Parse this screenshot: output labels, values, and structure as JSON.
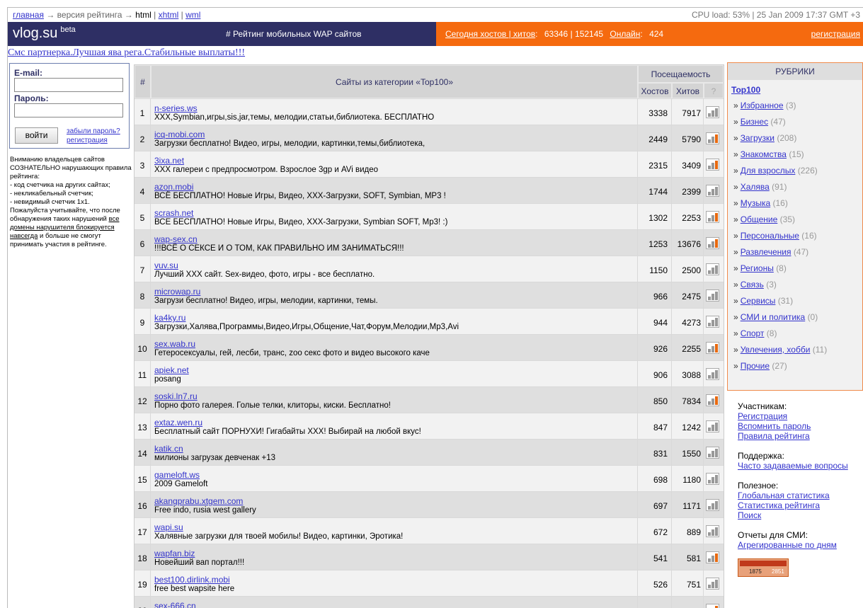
{
  "topline": {
    "home": "главная",
    "arrow1": "→",
    "rating_version": "версия рейтинга",
    "arrow2": "→",
    "html": "html",
    "sep1": "|",
    "xhtml": "xhtml",
    "sep2": "|",
    "wml": "wml",
    "cpu": "CPU load: 53%  |  25 Jan 2009 17:37 GMT +3"
  },
  "header": {
    "logo": "vlog.su",
    "beta": "beta",
    "tagline": "# Рейтинг мобильных WAP сайтов",
    "today_label": "Сегодня хостов | хитов",
    "today_values": "63346 | 152145",
    "online_label": "Онлайн",
    "online_value": "424",
    "register": "регистрация",
    "colors": {
      "left": "#2e2f64",
      "right": "#f56a0f"
    }
  },
  "promo": "Смс партнерка.Лучшая ява рега.Стабильные выплаты!!!",
  "login": {
    "email_label": "E-mail:",
    "password_label": "Пароль:",
    "submit": "войти",
    "forgot": "забыли пароль?",
    "register": "регистрация"
  },
  "warning": {
    "text1": "Вниманию владельцев сайтов СОЗНАТЕЛЬНО нарушающих правила рейтинга:",
    "text2": "- код счетчика на других сайтах;",
    "text3": "- некликабельный счетчик;",
    "text4": "- невидимый счетчик 1x1.",
    "text5": "Пожалуйста учитывайте, что после обнаружения таких нарушений",
    "link": "все домены нарушителя блокируется навсегда",
    "text6": "и больше не смогут принимать участия в рейтинге."
  },
  "table": {
    "col_num": "#",
    "col_sites": "Сайты из категории «Top100»",
    "col_visits": "Посещаемость",
    "col_hosts": "Хостов",
    "col_hits": "Хитов",
    "col_q": "?",
    "rows": [
      {
        "n": "1",
        "site": "n-series.ws",
        "desc": "XXX,Symbian,игры,sis,jar,темы, мелодии,статьи,библиотека. БЕСПЛАТНО",
        "hosts": "3338",
        "hits": "7917",
        "hot": false
      },
      {
        "n": "2",
        "site": "icq-mobi.com",
        "desc": "Загрузки бесплатно! Видео, игры, мелодии, картинки,темы,библиотека,",
        "hosts": "2449",
        "hits": "5790",
        "hot": true
      },
      {
        "n": "3",
        "site": "3ixa.net",
        "desc": "XXX галереи с предпросмотром. Взрослое 3gp и AVi видео",
        "hosts": "2315",
        "hits": "3409",
        "hot": true
      },
      {
        "n": "4",
        "site": "azon.mobi",
        "desc": "ВСЁ БЕСПЛАТНО! Новые Игры, Видео, XXX-Загрузки, SOFT, Symbian, MP3 !",
        "hosts": "1744",
        "hits": "2399",
        "hot": false
      },
      {
        "n": "5",
        "site": "scrash.net",
        "desc": "ВСЕ БЕСПЛАТНО! Новые Игры, Видео, XXX-Загрузки, Symbian SOFT, Mp3! :)",
        "hosts": "1302",
        "hits": "2253",
        "hot": true
      },
      {
        "n": "6",
        "site": "wap-sex.cn",
        "desc": "!!!ВСЁ О СЕКСЕ И О ТОМ, КАК ПРАВИЛЬНО ИМ ЗАНИМАТЬСЯ!!!",
        "hosts": "1253",
        "hits": "13676",
        "hot": true
      },
      {
        "n": "7",
        "site": "vuv.su",
        "desc": "Лучший XXX сайт. Sex-видео, фото, игры - все бесплатно.",
        "hosts": "1150",
        "hits": "2500",
        "hot": false
      },
      {
        "n": "8",
        "site": "microwap.ru",
        "desc": "Загрузи бесплатно! Видео, игры, мелодии, картинки, темы.",
        "hosts": "966",
        "hits": "2475",
        "hot": false
      },
      {
        "n": "9",
        "site": "ka4ky.ru",
        "desc": "Загрузки,Халява,Программы,Видео,Игры,Общение,Чат,Форум,Мелодии,Mp3,Avi",
        "hosts": "944",
        "hits": "4273",
        "hot": false
      },
      {
        "n": "10",
        "site": "sex.wab.ru",
        "desc": "Гетеросексуалы, гей, лесби, транс, zoo секс фото и видео высокого каче",
        "hosts": "926",
        "hits": "2255",
        "hot": true
      },
      {
        "n": "11",
        "site": "apiek.net",
        "desc": "posang",
        "hosts": "906",
        "hits": "3088",
        "hot": false
      },
      {
        "n": "12",
        "site": "soski.ln7.ru",
        "desc": "Порно фото галерея. Голые телки, клиторы, киски. Бесплатно!",
        "hosts": "850",
        "hits": "7834",
        "hot": true
      },
      {
        "n": "13",
        "site": "extaz.wen.ru",
        "desc": "Бесплатный сайт ПОРНУХИ! Гигабайты XXX! Выбирай на любой вкус!",
        "hosts": "847",
        "hits": "1242",
        "hot": false
      },
      {
        "n": "14",
        "site": "katik.cn",
        "desc": "милионы загрузак девченак +13",
        "hosts": "831",
        "hits": "1550",
        "hot": false
      },
      {
        "n": "15",
        "site": "gameloft.ws",
        "desc": "2009 Gameloft",
        "hosts": "698",
        "hits": "1180",
        "hot": false
      },
      {
        "n": "16",
        "site": "akangprabu.xtgem.com",
        "desc": "Free indo, rusia west gallery",
        "hosts": "697",
        "hits": "1171",
        "hot": false
      },
      {
        "n": "17",
        "site": "wapi.su",
        "desc": "Халявные загрузки для твоей мобилы! Видео, картинки, Эротика!",
        "hosts": "672",
        "hits": "889",
        "hot": false
      },
      {
        "n": "18",
        "site": "wapfan.biz",
        "desc": "Новейший вап портал!!!",
        "hosts": "541",
        "hits": "581",
        "hot": true
      },
      {
        "n": "19",
        "site": "best100.dirlink.mobi",
        "desc": "free best wapsite here",
        "hosts": "526",
        "hits": "751",
        "hot": false
      },
      {
        "n": "20",
        "site": "sex-666.cn",
        "desc": "",
        "hosts": "",
        "hits": "",
        "hot": true
      }
    ]
  },
  "rubrics": {
    "title": "РУБРИКИ",
    "top": "Top100",
    "items": [
      {
        "label": "Избранное",
        "count": "(3)"
      },
      {
        "label": "Бизнес",
        "count": "(47)"
      },
      {
        "label": "Загрузки",
        "count": "(208)"
      },
      {
        "label": "Знакомства",
        "count": "(15)"
      },
      {
        "label": "Для взрослых",
        "count": "(226)"
      },
      {
        "label": "Халява",
        "count": "(91)"
      },
      {
        "label": "Музыка",
        "count": "(16)"
      },
      {
        "label": "Общение",
        "count": "(35)"
      },
      {
        "label": "Персональные",
        "count": "(16)"
      },
      {
        "label": "Развлечения",
        "count": "(47)"
      },
      {
        "label": "Регионы",
        "count": "(8)"
      },
      {
        "label": "Связь",
        "count": "(3)"
      },
      {
        "label": "Сервисы",
        "count": "(31)"
      },
      {
        "label": "СМИ и политика",
        "count": "(0)"
      },
      {
        "label": "Спорт",
        "count": "(8)"
      },
      {
        "label": "Увлечения, хобби",
        "count": "(11)"
      },
      {
        "label": "Прочие",
        "count": "(27)"
      }
    ]
  },
  "side": {
    "participants": "Участникам:",
    "registration": "Регистрация",
    "remind": "Вспомнить пароль",
    "rules": "Правила рейтинга",
    "support": "Поддержка:",
    "faq": "Часто задаваемые вопросы",
    "useful": "Полезное:",
    "global_stats": "Глобальная статистика",
    "rating_stats": "Статистика рейтинга",
    "search": "Поиск",
    "media": "Отчеты для СМИ:",
    "aggregated": "Агрегированные по дням",
    "counter_a": "1875",
    "counter_b": "2851"
  }
}
